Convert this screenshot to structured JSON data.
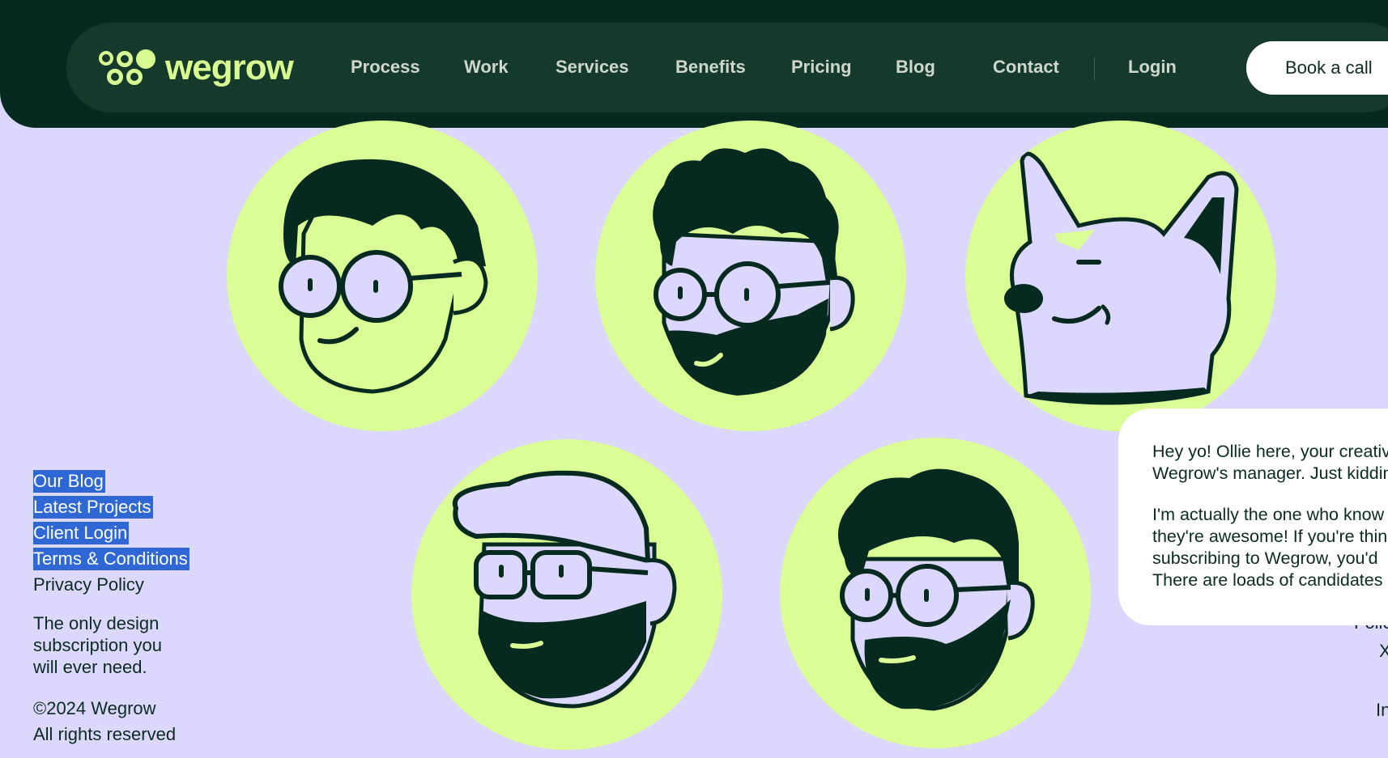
{
  "header": {
    "logo_text": "wegrow",
    "nav": [
      "Process",
      "Work",
      "Services",
      "Benefits",
      "Pricing",
      "Blog",
      "Contact",
      "Login"
    ],
    "cta": "Book a call"
  },
  "avatars": [
    {
      "name": "glasses-man"
    },
    {
      "name": "curly-bearded-man"
    },
    {
      "name": "dog-ollie"
    },
    {
      "name": "cap-bearded-man"
    },
    {
      "name": "bearded-man-glasses"
    }
  ],
  "footer": {
    "links": [
      "Our Blog",
      "Latest Projects",
      "Client Login",
      "Terms & Conditions",
      "Privacy Policy"
    ],
    "tagline": [
      "The only design",
      "subscription you",
      "will ever need."
    ],
    "copyright": [
      "©2024 Wegrow",
      "All rights reserved"
    ]
  },
  "chat": {
    "p1": [
      "Hey yo! Ollie here, your creative",
      "Wegrow's manager. Just kidding"
    ],
    "p2": [
      "I'm actually the one who know",
      "they're awesome! If you're thin",
      "subscribing to Wegrow, you'd",
      "There are loads of candidates"
    ]
  },
  "right_fragments": [
    "Follo",
    "X",
    "In"
  ],
  "colors": {
    "background": "#dcd7fd",
    "header_dark": "#062a20",
    "nav_bar": "#15392a",
    "brand_lime": "#d9fc92",
    "avatar_circle": "#dbfd95",
    "ink": "#0b2b22",
    "selection": "#2f68d4"
  }
}
